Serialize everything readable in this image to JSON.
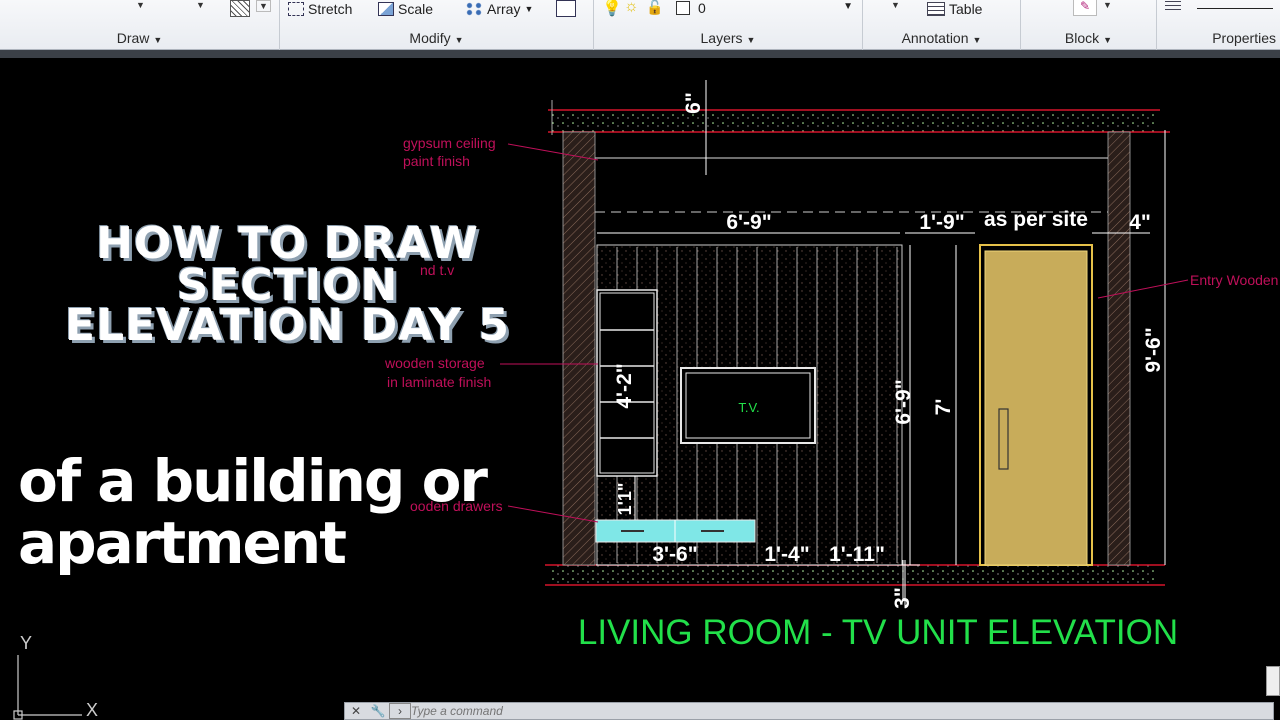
{
  "ribbon": {
    "panels": {
      "draw": "Draw",
      "modify": "Modify",
      "layers": "Layers",
      "annotation": "Annotation",
      "block": "Block",
      "properties": "Properties"
    },
    "tools": {
      "stretch": "Stretch",
      "scale": "Scale",
      "array": "Array",
      "layer_value": "0",
      "table": "Table"
    }
  },
  "overlay": {
    "title_line1": "HOW TO DRAW",
    "title_line2": "SECTION",
    "title_line3": "ELEVATION DAY 5",
    "subtitle_line1": "of a building or",
    "subtitle_line2": "apartment"
  },
  "drawing": {
    "title": "LIVING ROOM - TV UNIT ELEVATION",
    "dims": {
      "top_slab": "6\"",
      "tv_wall_width": "6'-9\"",
      "door_gap": "1'-9\"",
      "as_per_site": "as per site",
      "right_wall": "4\"",
      "total_height": "9'-6\"",
      "door_height": "7'",
      "panel_height": "6'-9\"",
      "storage_height": "4'-2\"",
      "drawer_height": "1'1\"",
      "drawer_width": "3'-6\"",
      "gap1": "1'-4\"",
      "gap2": "1'-11\"",
      "floor": "3\""
    },
    "labels": {
      "gypsum_1": "gypsum ceiling",
      "gypsum_2": "paint finish",
      "behind_tv": "nd t.v",
      "storage_1": "wooden storage",
      "storage_2": "in laminate finish",
      "drawers": "ooden drawers",
      "tv": "T.V.",
      "entry": "Entry Wooden"
    },
    "colors": {
      "dim": "#ffffff",
      "leader": "#c0105a",
      "title": "#22e04a",
      "door": "#c8ac5a",
      "drawer": "#7fe7e7",
      "slab_line": "#d4142a"
    }
  },
  "ucs": {
    "x": "X",
    "y": "Y"
  },
  "command": {
    "placeholder": "Type a command"
  }
}
